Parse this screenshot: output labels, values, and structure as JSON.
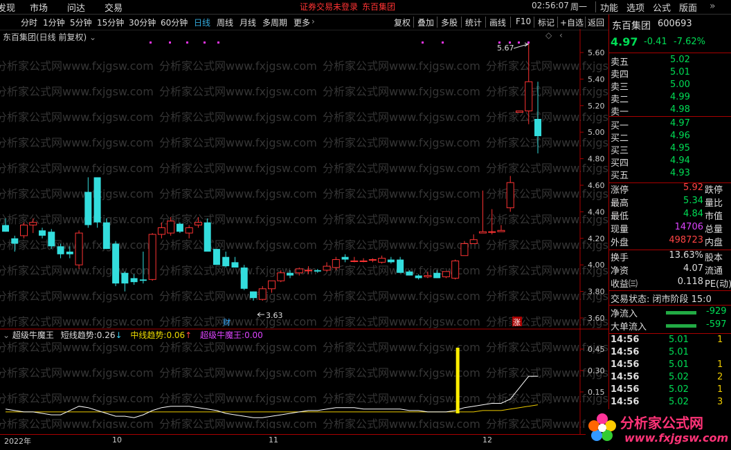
{
  "menu": {
    "items": [
      "发现",
      "市场",
      "问达",
      "交易"
    ],
    "notice": "证券交易未登录",
    "stock": "东百集团",
    "clock": "02:56:07",
    "weekday": "周一",
    "right_items": [
      "功能",
      "选项",
      "公式",
      "版面"
    ]
  },
  "toolbar": {
    "periods": [
      "分时",
      "1分钟",
      "5分钟",
      "15分钟",
      "30分钟",
      "60分钟",
      "日线",
      "周线",
      "月线",
      "多周期",
      "更多"
    ],
    "active": "日线",
    "tools": [
      "复权",
      "叠加",
      "多股",
      "统计",
      "画线",
      "F10",
      "标记",
      "+自选",
      "返回"
    ]
  },
  "chart_title": "东百集团(日线 前复权)",
  "watermark": "分析家公式网www.fxjgsw.com",
  "main_chart": {
    "type": "candlestick",
    "ylim": [
      3.5,
      5.75
    ],
    "yticks": [
      "5.60",
      "5.40",
      "5.20",
      "5.00",
      "4.80",
      "4.60",
      "4.40",
      "4.20",
      "4.00",
      "3.80",
      "3.60"
    ],
    "xlabels": [
      "2022年",
      "10",
      "11",
      "12"
    ],
    "high_label": "5.67",
    "low_label": "3.63",
    "markers": [
      "财",
      "涨"
    ],
    "candles": [
      [
        4.3,
        4.35,
        4.25,
        4.25
      ],
      [
        4.2,
        4.22,
        4.1,
        4.16
      ],
      [
        4.22,
        4.32,
        4.2,
        4.3
      ],
      [
        4.3,
        4.35,
        4.24,
        4.32
      ],
      [
        4.26,
        4.28,
        4.2,
        4.22
      ],
      [
        4.25,
        4.27,
        4.12,
        4.14
      ],
      [
        4.14,
        4.16,
        4.05,
        4.08
      ],
      [
        4.1,
        4.14,
        4.05,
        4.08
      ],
      [
        4.0,
        4.26,
        3.97,
        4.24
      ],
      [
        4.55,
        4.66,
        4.28,
        4.3
      ],
      [
        4.66,
        4.66,
        4.28,
        4.32
      ],
      [
        4.32,
        4.35,
        4.12,
        4.12
      ],
      [
        4.16,
        4.18,
        3.84,
        3.86
      ],
      [
        3.94,
        3.95,
        3.8,
        3.86
      ],
      [
        3.9,
        3.93,
        3.85,
        3.87
      ],
      [
        3.89,
        4.1,
        3.86,
        3.88
      ],
      [
        3.89,
        4.24,
        3.88,
        4.23
      ],
      [
        4.23,
        4.32,
        4.2,
        4.28
      ],
      [
        4.24,
        4.36,
        4.22,
        4.33
      ],
      [
        4.31,
        4.32,
        4.24,
        4.25
      ],
      [
        4.24,
        4.3,
        4.2,
        4.28
      ],
      [
        4.3,
        4.36,
        4.28,
        4.32
      ],
      [
        4.32,
        4.35,
        4.1,
        4.1
      ],
      [
        4.12,
        4.12,
        4.0,
        4.0
      ],
      [
        4.06,
        4.1,
        3.98,
        3.99
      ],
      [
        4.02,
        4.06,
        3.98,
        3.98
      ],
      [
        3.98,
        4.0,
        3.81,
        3.82
      ],
      [
        3.8,
        3.8,
        3.73,
        3.75
      ],
      [
        3.74,
        3.84,
        3.73,
        3.82
      ],
      [
        3.82,
        3.88,
        3.79,
        3.88
      ],
      [
        3.88,
        3.96,
        3.87,
        3.94
      ],
      [
        3.94,
        3.96,
        3.9,
        3.92
      ],
      [
        3.94,
        3.98,
        3.92,
        3.97
      ],
      [
        3.96,
        3.99,
        3.93,
        3.96
      ],
      [
        3.96,
        3.97,
        3.94,
        3.95
      ],
      [
        3.96,
        4.02,
        3.95,
        3.99
      ],
      [
        3.98,
        4.06,
        3.96,
        4.04
      ],
      [
        4.06,
        4.08,
        4.02,
        4.04
      ],
      [
        4.03,
        4.06,
        4.02,
        4.03
      ],
      [
        4.03,
        4.05,
        4.02,
        4.03
      ],
      [
        4.04,
        4.05,
        4.02,
        4.04
      ],
      [
        4.02,
        4.07,
        4.01,
        4.05
      ],
      [
        4.04,
        4.06,
        4.01,
        4.02
      ],
      [
        4.04,
        4.06,
        3.94,
        3.94
      ],
      [
        3.95,
        3.96,
        3.92,
        3.92
      ],
      [
        3.92,
        3.93,
        3.89,
        3.9
      ],
      [
        3.91,
        3.95,
        3.9,
        3.92
      ],
      [
        3.94,
        3.96,
        3.9,
        3.9
      ],
      [
        3.91,
        3.95,
        3.9,
        3.95
      ],
      [
        3.9,
        4.04,
        3.89,
        4.03
      ],
      [
        4.07,
        4.18,
        4.07,
        4.16
      ],
      [
        4.16,
        4.23,
        4.16,
        4.19
      ],
      [
        4.24,
        4.56,
        4.24,
        4.25
      ],
      [
        4.25,
        4.42,
        4.23,
        4.25
      ],
      [
        4.25,
        4.3,
        4.25,
        4.26
      ],
      [
        4.43,
        4.67,
        4.4,
        4.62
      ],
      [
        5.15,
        5.15,
        5.15,
        5.16
      ],
      [
        5.16,
        5.67,
        5.06,
        5.38
      ],
      [
        5.1,
        5.38,
        4.84,
        4.97
      ]
    ]
  },
  "indicator": {
    "header": "超级牛魔王",
    "short_label": "短线趋势:",
    "short_value": "0.26",
    "short_arrow": "↓",
    "mid_label": "中线趋势:",
    "mid_value": "0.06",
    "mid_arrow": "↑",
    "king_label": "超级牛魔王:",
    "king_value": "0.00",
    "yticks": [
      "0.45",
      "0.30",
      "0.15"
    ],
    "ylim": [
      -0.05,
      0.5
    ],
    "short_series": [
      0.03,
      0.02,
      0.01,
      0.01,
      0.0,
      -0.01,
      -0.01,
      0.02,
      0.05,
      0.04,
      0.02,
      0.0,
      -0.02,
      -0.02,
      -0.03,
      -0.01,
      0.02,
      0.04,
      0.05,
      0.05,
      0.05,
      0.04,
      0.03,
      0.02,
      0.0,
      -0.01,
      -0.02,
      -0.03,
      -0.03,
      -0.02,
      -0.01,
      0.0,
      0.01,
      0.02,
      0.02,
      0.03,
      0.04,
      0.04,
      0.04,
      0.03,
      0.03,
      0.03,
      0.03,
      0.03,
      0.02,
      0.02,
      0.01,
      0.01,
      0.01,
      0.02,
      0.04,
      0.05,
      0.06,
      0.07,
      0.07,
      0.1,
      0.18,
      0.26,
      0.26
    ],
    "mid_series": [
      0.01,
      0.01,
      0.01,
      0.01,
      0.01,
      0.01,
      0.01,
      0.01,
      0.01,
      0.01,
      0.01,
      0.01,
      0.01,
      0.01,
      0.01,
      0.01,
      0.01,
      0.01,
      0.01,
      0.01,
      0.01,
      0.01,
      0.01,
      0.01,
      0.01,
      0.01,
      0.01,
      0.01,
      0.01,
      0.01,
      0.01,
      0.01,
      0.01,
      0.01,
      0.01,
      0.01,
      0.01,
      0.01,
      0.01,
      0.01,
      0.01,
      0.01,
      0.01,
      0.01,
      0.01,
      0.01,
      0.01,
      0.01,
      0.01,
      0.01,
      0.01,
      0.01,
      0.02,
      0.02,
      0.02,
      0.03,
      0.04,
      0.05,
      0.06
    ],
    "signal_bar_index": 49,
    "signal_bar_value": 0.45
  },
  "quote": {
    "name": "东百集团",
    "code": "600693",
    "price": "4.97",
    "change": "-0.41",
    "pct": "-7.62%",
    "asks": [
      [
        "卖五",
        "5.02"
      ],
      [
        "卖四",
        "5.01"
      ],
      [
        "卖三",
        "5.00"
      ],
      [
        "卖二",
        "4.99"
      ],
      [
        "卖一",
        "4.98"
      ]
    ],
    "bids": [
      [
        "买一",
        "4.97"
      ],
      [
        "买二",
        "4.96"
      ],
      [
        "买三",
        "4.95"
      ],
      [
        "买四",
        "4.94"
      ],
      [
        "买五",
        "4.93"
      ]
    ],
    "stats": [
      {
        "l": "涨停",
        "v": "5.92",
        "r": "跌停",
        "c": "#ff4444"
      },
      {
        "l": "最高",
        "v": "5.34",
        "r": "量比",
        "c": "#00dd55"
      },
      {
        "l": "最低",
        "v": "4.84",
        "r": "市值",
        "c": "#00dd55"
      },
      {
        "l": "现量",
        "v": "14706",
        "r": "总量",
        "c": "#dd44ff"
      },
      {
        "l": "外盘",
        "v": "498723",
        "r": "内盘",
        "c": "#ff4444"
      }
    ],
    "stats2": [
      {
        "l": "换手",
        "v": "13.63%",
        "r": "股本",
        "c": "#dddddd"
      },
      {
        "l": "净资",
        "v": "4.07",
        "r": "流通",
        "c": "#dddddd"
      },
      {
        "l": "收益㈢",
        "v": "0.118",
        "r": "PE(动)",
        "c": "#dddddd"
      }
    ],
    "trade_status": "交易状态: 闭市阶段 15:0",
    "flows": [
      {
        "l": "净流入",
        "v": "-929"
      },
      {
        "l": "大单流入",
        "v": "-597"
      }
    ],
    "ticks": [
      [
        "14:56",
        "5.01",
        "1"
      ],
      [
        "14:56",
        "5.01",
        ""
      ],
      [
        "14:56",
        "5.01",
        "1"
      ],
      [
        "14:56",
        "5.02",
        "2"
      ],
      [
        "14:56",
        "5.02",
        "1"
      ],
      [
        "14:56",
        "5.02",
        "3"
      ]
    ]
  },
  "logo": {
    "text": "分析家公式网",
    "url": "www.fxjgsw.com"
  }
}
